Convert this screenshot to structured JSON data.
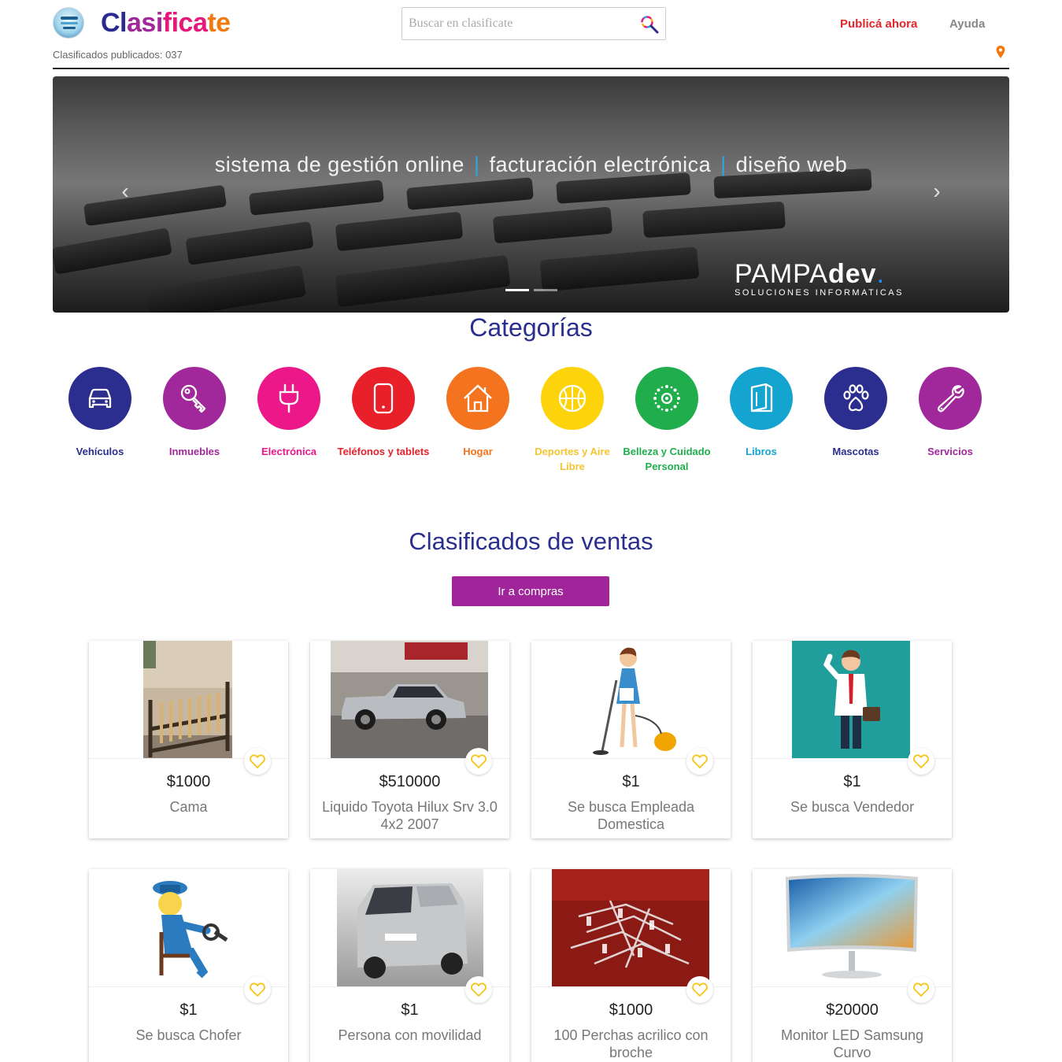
{
  "header": {
    "brand": {
      "a": "Cl",
      "b": "asi",
      "c": "fica",
      "d": "te"
    },
    "count_label": "Clasificados publicados: 037",
    "search_placeholder": "Buscar en clasificate",
    "publish_label": "Publicá ahora",
    "help_label": "Ayuda"
  },
  "carousel": {
    "part1": "sistema de gestión online",
    "sep": "|",
    "part2": "facturación electrónica",
    "part3": "diseño web",
    "brand_a": "PAMPA",
    "brand_b": "dev",
    "brand_dot": ".",
    "brand_sub": "SOLUCIONES INFORMATICAS",
    "prev_icon": "‹",
    "next_icon": "›",
    "slides": 2,
    "active_slide": 1
  },
  "categories": {
    "title": "Categorías",
    "items": [
      {
        "label": "Vehículos",
        "color": "#2b2d8f",
        "text_color": "#2b2d8f",
        "icon": "car-icon"
      },
      {
        "label": "Inmuebles",
        "color": "#a0289a",
        "text_color": "#a0289a",
        "icon": "key-icon"
      },
      {
        "label": "Electrónica",
        "color": "#ec1789",
        "text_color": "#ec1789",
        "icon": "plug-icon"
      },
      {
        "label": "Teléfonos y tablets",
        "color": "#e8202a",
        "text_color": "#e8202a",
        "icon": "phone-icon"
      },
      {
        "label": "Hogar",
        "color": "#f4731f",
        "text_color": "#f4731f",
        "icon": "house-icon"
      },
      {
        "label": "Deportes y Aire Libre",
        "color": "#fdd30b",
        "text_color": "#f4c430",
        "icon": "ball-icon"
      },
      {
        "label": "Belleza y Cuidado Personal",
        "color": "#1fae4b",
        "text_color": "#1fae4b",
        "icon": "sparkle-icon"
      },
      {
        "label": "Libros",
        "color": "#13a4cf",
        "text_color": "#13a4cf",
        "icon": "book-icon"
      },
      {
        "label": "Mascotas",
        "color": "#2b2d8f",
        "text_color": "#2b2d8f",
        "icon": "paw-icon"
      },
      {
        "label": "Servicios",
        "color": "#a0289a",
        "text_color": "#a0289a",
        "icon": "wrench-icon"
      }
    ]
  },
  "sales": {
    "title": "Clasificados de ventas",
    "button_label": "Ir a compras",
    "items": [
      {
        "price": "$1000",
        "title": "Cama",
        "image": "bed-photo"
      },
      {
        "price": "$510000",
        "title": "Liquido Toyota Hilux Srv 3.0 4x2 2007",
        "image": "pickup-photo"
      },
      {
        "price": "$1",
        "title": "Se busca Empleada Domestica",
        "image": "cleaner-illustration"
      },
      {
        "price": "$1",
        "title": "Se busca Vendedor",
        "image": "salesman-illustration"
      },
      {
        "price": "$1",
        "title": "Se busca Chofer",
        "image": "driver-illustration"
      },
      {
        "price": "$1",
        "title": "Persona con movilidad",
        "image": "van-photo"
      },
      {
        "price": "$1000",
        "title": "100 Perchas acrilico con broche",
        "image": "hangers-photo"
      },
      {
        "price": "$20000",
        "title": "Monitor LED Samsung Curvo",
        "image": "monitor-photo"
      }
    ]
  }
}
